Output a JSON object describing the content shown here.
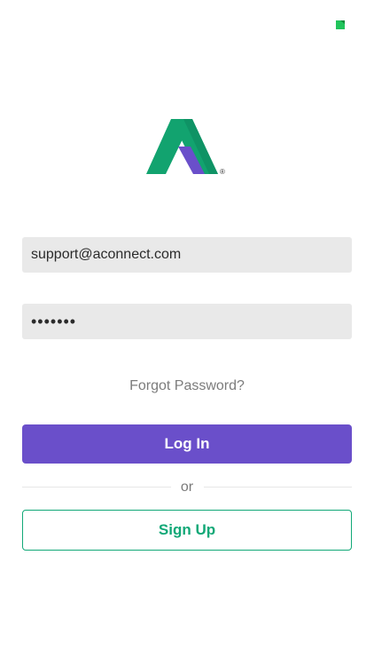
{
  "status_bar": {
    "battery_icon": "battery-charging-icon",
    "battery_color": "#21c45b"
  },
  "logo": {
    "icon": "a-logo-icon",
    "registered_mark": "®",
    "colors": {
      "green_dark": "#0f8f63",
      "green": "#11a877",
      "purple": "#6a4fca"
    }
  },
  "login_form": {
    "email_value": "support@aconnect.com",
    "password_value": "•••••••",
    "forgot_label": "Forgot Password?",
    "login_label": "Log In",
    "or_label": "or",
    "signup_label": "Sign Up"
  },
  "colors": {
    "primary": "#6a4fca",
    "accent": "#11a877",
    "input_bg": "#e9e9e9"
  }
}
